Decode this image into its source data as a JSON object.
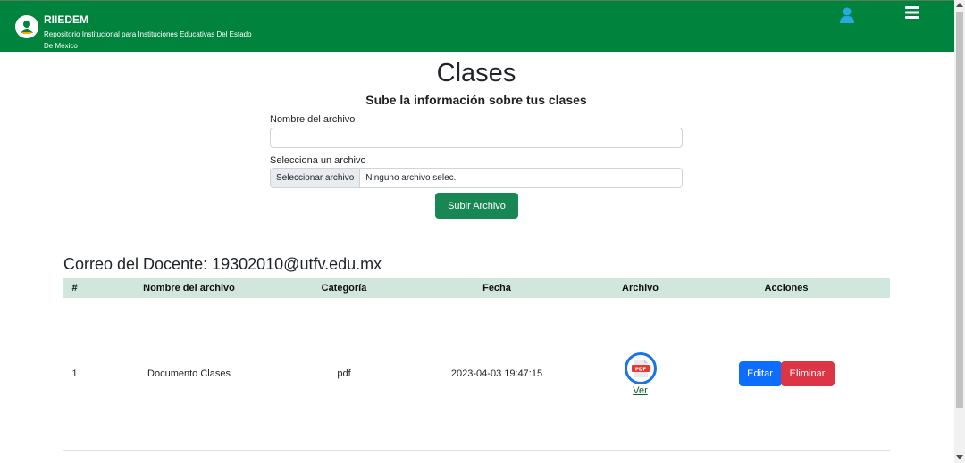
{
  "header": {
    "brand_name": "RIIEDEM",
    "brand_subtitle": "Repositorio Institucional para Instituciones Educativas Del Estado De México",
    "color": "#00843d",
    "user_icon": "user-icon",
    "menu_icon": "hamburger-menu-icon"
  },
  "form": {
    "title": "Clases",
    "subtitle": "Sube la información sobre tus clases",
    "name_label": "Nombre del archivo",
    "name_value": "",
    "file_label": "Selecciona un archivo",
    "file_button": "Seleccionar archivo",
    "file_status": "Ninguno archivo selec.",
    "submit_label": "Subir Archivo"
  },
  "table": {
    "heading": "Correo del Docente: 19302010@utfv.edu.mx",
    "columns": [
      "#",
      "Nombre del archivo",
      "Categoría",
      "Fecha",
      "Archivo",
      "Acciones"
    ],
    "rows": [
      {
        "index": "1",
        "name": "Documento Clases",
        "category": "pdf",
        "date": "2023-04-03 19:47:15",
        "file_icon": "pdf-icon",
        "file_link": "Ver",
        "edit_label": "Editar",
        "delete_label": "Eliminar"
      }
    ]
  },
  "colors": {
    "header_green": "#00843d",
    "submit_green": "#198754",
    "table_header_bg": "#d1e7dd",
    "edit_blue": "#0d6efd",
    "delete_red": "#dc3545"
  }
}
